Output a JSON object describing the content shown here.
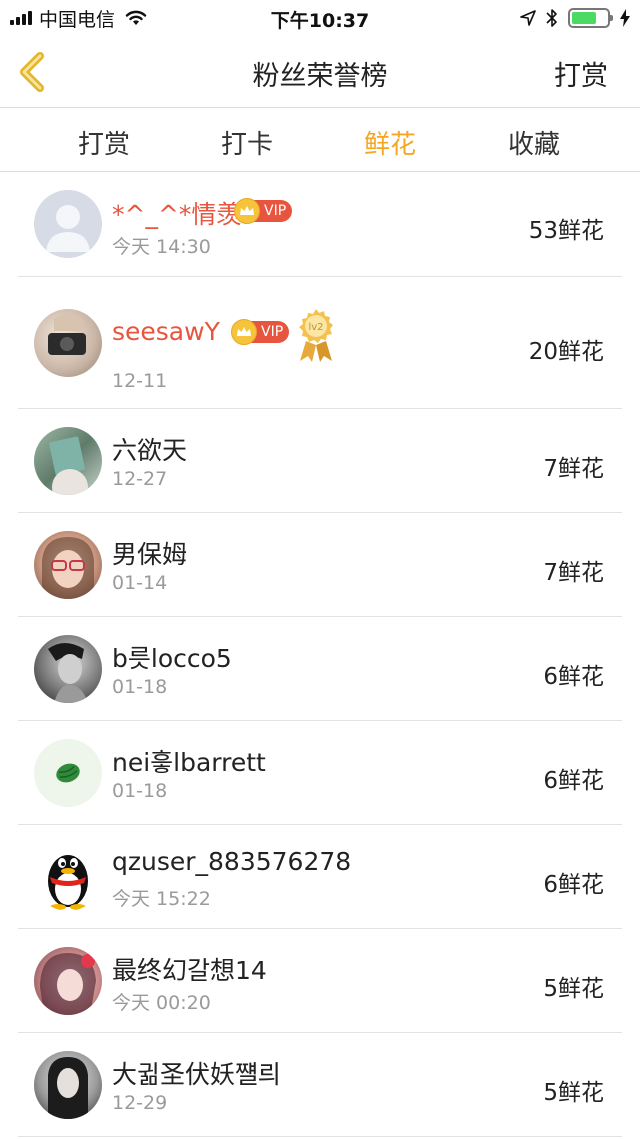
{
  "status_bar": {
    "carrier": "中国电信",
    "time": "下午10:37"
  },
  "nav": {
    "title": "粉丝荣誉榜",
    "action_label": "打赏"
  },
  "tabs": [
    {
      "label": "打赏",
      "active": false
    },
    {
      "label": "打卡",
      "active": false
    },
    {
      "label": "鲜花",
      "active": true
    },
    {
      "label": "收藏",
      "active": false
    }
  ],
  "vip_label": "VIP",
  "medal_label": "lv2",
  "colors": {
    "accent": "#f5a623",
    "vip_name": "#e8553f",
    "battery": "#4cd964"
  },
  "ranking": [
    {
      "name": "*^_^*情羡",
      "date": "今天 14:30",
      "count": "53鲜花",
      "vip": true,
      "medal": false,
      "avatar": "default-avatar"
    },
    {
      "name": "seesawY",
      "date": "12-11",
      "count": "20鲜花",
      "vip": true,
      "medal": true,
      "avatar": "photo-avatar"
    },
    {
      "name": "六欲天",
      "date": "12-27",
      "count": "7鲜花",
      "vip": false,
      "medal": false,
      "avatar": "photo-avatar"
    },
    {
      "name": "男保姆",
      "date": "01-14",
      "count": "7鲜花",
      "vip": false,
      "medal": false,
      "avatar": "photo-avatar"
    },
    {
      "name": "b릇locco5",
      "date": "01-18",
      "count": "6鲜花",
      "vip": false,
      "medal": false,
      "avatar": "photo-avatar"
    },
    {
      "name": "nei흫lbarrett",
      "date": "01-18",
      "count": "6鲜花",
      "vip": false,
      "medal": false,
      "avatar": "watermelon-avatar"
    },
    {
      "name": "qzuser_883576278",
      "date": "今天 15:22",
      "count": "6鲜花",
      "vip": false,
      "medal": false,
      "avatar": "penguin-avatar"
    },
    {
      "name": "最终幻갈想14",
      "date": "今天 00:20",
      "count": "5鲜花",
      "vip": false,
      "medal": false,
      "avatar": "photo-avatar"
    },
    {
      "name": "大귊圣伏妖쨸릐",
      "date": "12-29",
      "count": "5鲜花",
      "vip": false,
      "medal": false,
      "avatar": "photo-avatar"
    }
  ]
}
